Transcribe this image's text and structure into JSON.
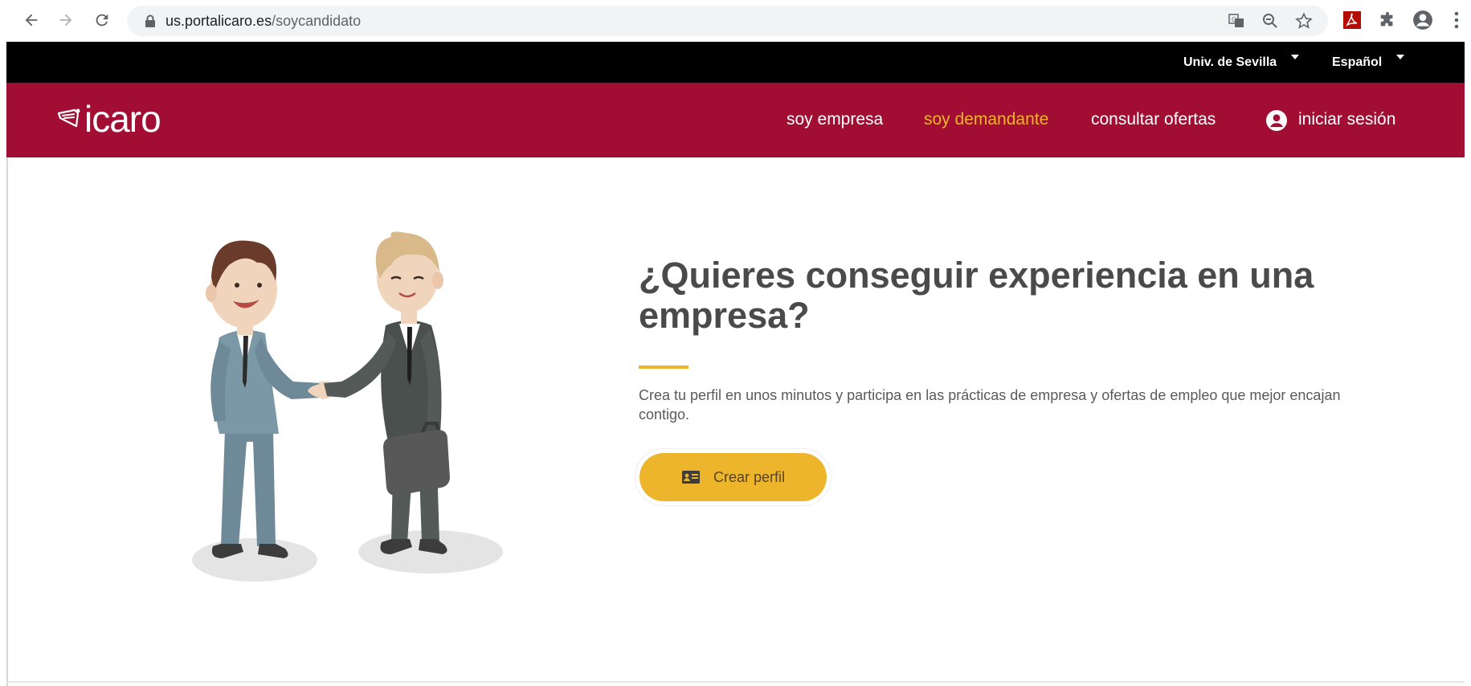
{
  "browser": {
    "url_domain": "us.portalicaro.es",
    "url_path": "/soycandidato",
    "icons": [
      "back-arrow-icon",
      "forward-arrow-icon",
      "reload-icon",
      "lock-icon",
      "translate-icon",
      "zoom-icon",
      "star-icon",
      "pdf-extension-icon",
      "puzzle-icon",
      "account-icon",
      "more-vert-icon"
    ]
  },
  "topbar": {
    "university": "Univ. de Sevilla",
    "language": "Español"
  },
  "header": {
    "logo_text": "icaro",
    "nav": {
      "empresa": "soy empresa",
      "demandante": "soy demandante",
      "ofertas": "consultar ofertas",
      "login": "iniciar sesión"
    },
    "colors": {
      "brand": "#a20d33",
      "active": "#f0b429"
    }
  },
  "hero": {
    "title": "¿Quieres conseguir experiencia en una empresa?",
    "description": "Crea tu perfil en unos minutos y participa en las prácticas de empresa y ofertas de empleo que mejor encajan contigo.",
    "cta_label": "Crear perfil",
    "cta_color": "#edb52b"
  }
}
